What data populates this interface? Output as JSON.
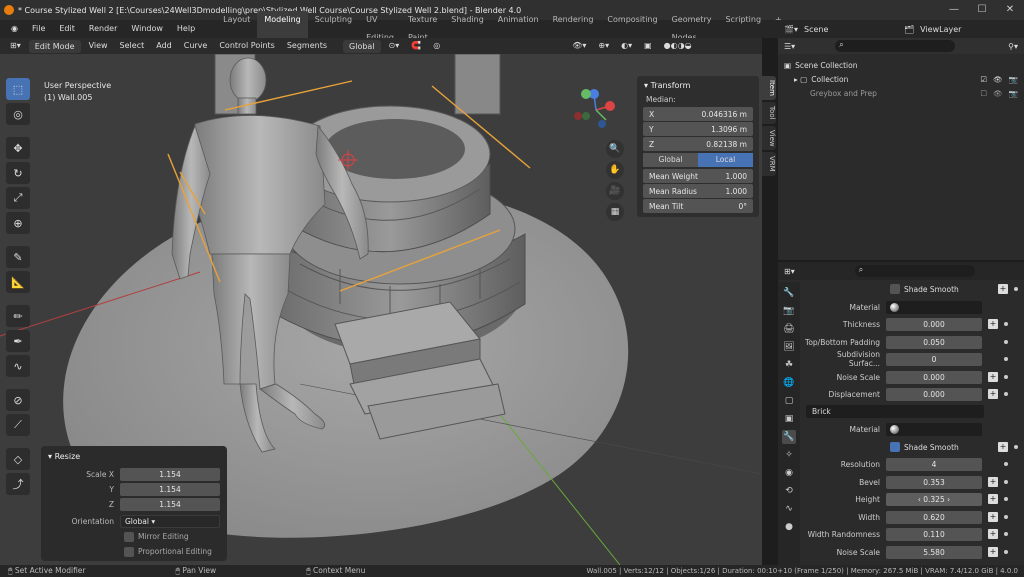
{
  "window": {
    "title": "* Course Stylized Well 2 [E:\\Courses\\24Well3Dmodelling\\prep\\Stylized Well Course\\Course Stylized Well 2.blend] - Blender 4.0",
    "minimize": "—",
    "maximize": "☐",
    "close": "✕"
  },
  "menu": [
    "File",
    "Edit",
    "Render",
    "Window",
    "Help"
  ],
  "workspaces": [
    "Layout",
    "Modeling",
    "Sculpting",
    "UV Editing",
    "Texture Paint",
    "Shading",
    "Animation",
    "Rendering",
    "Compositing",
    "Geometry Nodes",
    "Scripting",
    "+"
  ],
  "active_workspace": "Modeling",
  "viewport_header": {
    "mode": "Edit Mode",
    "items": [
      "View",
      "Select",
      "Add",
      "Curve",
      "Control Points",
      "Segments"
    ],
    "orientation": "Global"
  },
  "viewport": {
    "perspective": "User Perspective",
    "object": "(1) Wall.005"
  },
  "tools": [
    "select-box",
    "cursor",
    "move",
    "rotate",
    "scale",
    "transform",
    "annotate",
    "measure",
    "draw",
    "pen",
    "curve",
    "radius",
    "tilt",
    "randomize",
    "extrude",
    "shrink"
  ],
  "transform_panel": {
    "title": "Transform",
    "median_label": "Median:",
    "x_label": "X",
    "x": "0.046316 m",
    "y_label": "Y",
    "y": "1.3096 m",
    "z_label": "Z",
    "z": "0.82138 m",
    "global": "Global",
    "local": "Local",
    "mean_weight_label": "Mean Weight",
    "mean_weight": "1.000",
    "mean_radius_label": "Mean Radius",
    "mean_radius": "1.000",
    "mean_tilt_label": "Mean Tilt",
    "mean_tilt": "0°"
  },
  "side_tabs": [
    "Item",
    "Tool",
    "View",
    "VRM"
  ],
  "resize_panel": {
    "title": "Resize",
    "scale_x_label": "Scale X",
    "scale_x": "1.154",
    "y_label": "Y",
    "y": "1.154",
    "z_label": "Z",
    "z": "1.154",
    "orientation_label": "Orientation",
    "orientation": "Global",
    "mirror_editing": "Mirror Editing",
    "proportional_editing": "Proportional Editing"
  },
  "statusbar": {
    "left": "Set Active Modifier",
    "middle": "Pan View",
    "right": "Context Menu",
    "stats": "Wall.005 | Verts:12/12 | Objects:1/26 | Duration: 00:10+10 (Frame 1/250) | Memory: 267.5 MiB | VRAM: 7.4/12.0 GiB | 4.0.0"
  },
  "outliner": {
    "scene": "Scene",
    "view_layer": "ViewLayer",
    "scene_collection": "Scene Collection",
    "items": [
      {
        "name": "Collection"
      },
      {
        "name": "Greybox and Prep"
      }
    ]
  },
  "properties": {
    "shade_smooth": "Shade Smooth",
    "rows_top": [
      {
        "label": "Material",
        "value": "",
        "type": "material"
      },
      {
        "label": "Thickness",
        "value": "0.000"
      },
      {
        "label": "Top/Bottom Padding",
        "value": "0.050"
      },
      {
        "label": "Subdivision Surfac...",
        "value": "0"
      },
      {
        "label": "Noise Scale",
        "value": "0.000"
      },
      {
        "label": "Displacement",
        "value": "0.000"
      }
    ],
    "section": "Brick",
    "brick_material_label": "Material",
    "brick_shade_smooth": "Shade Smooth",
    "rows_brick": [
      {
        "label": "Resolution",
        "value": "4"
      },
      {
        "label": "Bevel",
        "value": "0.353"
      },
      {
        "label": "Height",
        "value": "0.325"
      },
      {
        "label": "Width",
        "value": "0.620"
      },
      {
        "label": "Width Randomness",
        "value": "0.110"
      },
      {
        "label": "Noise Scale",
        "value": "5.580"
      }
    ]
  },
  "colors": {
    "accent": "#4772b3",
    "viewport": "#3d3d3d",
    "panel": "#2b2b2b",
    "orange_curve": "#e8a23a"
  }
}
